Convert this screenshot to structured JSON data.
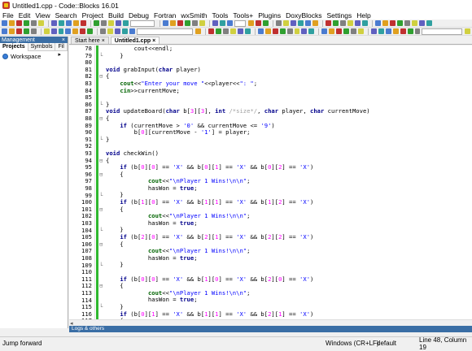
{
  "window": {
    "title": "Untitled1.cpp - Code::Blocks 16.01"
  },
  "menu": [
    "File",
    "Edit",
    "View",
    "Search",
    "Project",
    "Build",
    "Debug",
    "Fortran",
    "wxSmith",
    "Tools",
    "Tools+",
    "Plugins",
    "DoxyBlocks",
    "Settings",
    "Help"
  ],
  "management": {
    "title": "Management",
    "close": "×",
    "tabs": [
      "Projects",
      "Symbols",
      "Fil ▸"
    ],
    "workspace_label": "Workspace"
  },
  "editor_tabs": [
    {
      "label": "Start here",
      "close": "×"
    },
    {
      "label": "Untitled1.cpp",
      "close": "×"
    }
  ],
  "code_lines": [
    {
      "n": "78",
      "fold": "",
      "html": "        <span class='fn'>cout</span>&lt;&lt;endl;"
    },
    {
      "n": "79",
      "fold": "└",
      "html": "    }"
    },
    {
      "n": "80",
      "fold": "",
      "html": ""
    },
    {
      "n": "81",
      "fold": "",
      "html": "<span class='kw'>void</span> grabInput(<span class='kw'>char</span> player)"
    },
    {
      "n": "82",
      "fold": "⊟",
      "html": "{"
    },
    {
      "n": "83",
      "fold": "",
      "html": "    <span class='grn'>cout</span>&lt;&lt;<span class='str'>\"Enter your move \"</span>&lt;&lt;player&lt;&lt;<span class='str'>\": \"</span>;"
    },
    {
      "n": "84",
      "fold": "",
      "html": "    <span class='grn'>cin</span>&gt;&gt;currentMove;"
    },
    {
      "n": "85",
      "fold": "",
      "html": ""
    },
    {
      "n": "86",
      "fold": "└",
      "html": "}"
    },
    {
      "n": "87",
      "fold": "",
      "html": "<span class='kw'>void</span> updateBoard(<span class='kw'>char</span> b[<span class='num'>3</span>][<span class='num'>3</span>], <span class='kw'>int</span> <span class='com'>/*size*/</span>, <span class='kw'>char</span> player, <span class='kw'>char</span> currentMove)"
    },
    {
      "n": "88",
      "fold": "⊟",
      "html": "{"
    },
    {
      "n": "89",
      "fold": "",
      "html": "    <span class='kw'>if</span> (currentMove &gt; <span class='str'>'0'</span> &amp;&amp; currentMove &lt;= <span class='str'>'9'</span>)"
    },
    {
      "n": "90",
      "fold": "",
      "html": "        b[<span class='num'>0</span>][currentMove - <span class='str'>'1'</span>] = player;"
    },
    {
      "n": "91",
      "fold": "└",
      "html": "}"
    },
    {
      "n": "92",
      "fold": "",
      "html": ""
    },
    {
      "n": "93",
      "fold": "",
      "html": "<span class='kw'>void</span> checkWin()"
    },
    {
      "n": "94",
      "fold": "⊟",
      "html": "{"
    },
    {
      "n": "95",
      "fold": "",
      "html": "    <span class='kw'>if</span> (b[<span class='num'>0</span>][<span class='num'>0</span>] == <span class='str'>'X'</span> &amp;&amp; b[<span class='num'>0</span>][<span class='num'>1</span>] == <span class='str'>'X'</span> &amp;&amp; b[<span class='num'>0</span>][<span class='num'>2</span>] == <span class='str'>'X'</span>)"
    },
    {
      "n": "96",
      "fold": "⊟",
      "html": "    {"
    },
    {
      "n": "97",
      "fold": "",
      "html": "            <span class='grn'>cout</span>&lt;&lt;<span class='str'>\"\\nPlayer 1 Wins!\\n\\n\"</span>;"
    },
    {
      "n": "98",
      "fold": "",
      "html": "            hasWon = <span class='kw'>true</span>;"
    },
    {
      "n": "99",
      "fold": "└",
      "html": "    }"
    },
    {
      "n": "100",
      "fold": "",
      "html": "    <span class='kw'>if</span> (b[<span class='num'>1</span>][<span class='num'>0</span>] == <span class='str'>'X'</span> &amp;&amp; b[<span class='num'>1</span>][<span class='num'>1</span>] == <span class='str'>'X'</span> &amp;&amp; b[<span class='num'>1</span>][<span class='num'>2</span>] == <span class='str'>'X'</span>)"
    },
    {
      "n": "101",
      "fold": "⊟",
      "html": "    {"
    },
    {
      "n": "102",
      "fold": "",
      "html": "            <span class='grn'>cout</span>&lt;&lt;<span class='str'>\"\\nPlayer 1 Wins!\\n\\n\"</span>;"
    },
    {
      "n": "103",
      "fold": "",
      "html": "            hasWon = <span class='kw'>true</span>;"
    },
    {
      "n": "104",
      "fold": "└",
      "html": "    }"
    },
    {
      "n": "105",
      "fold": "",
      "html": "    <span class='kw'>if</span> (b[<span class='num'>2</span>][<span class='num'>0</span>] == <span class='str'>'X'</span> &amp;&amp; b[<span class='num'>2</span>][<span class='num'>1</span>] == <span class='str'>'X'</span> &amp;&amp; b[<span class='num'>2</span>][<span class='num'>2</span>] == <span class='str'>'X'</span>)"
    },
    {
      "n": "106",
      "fold": "⊟",
      "html": "    {"
    },
    {
      "n": "107",
      "fold": "",
      "html": "            <span class='grn'>cout</span>&lt;&lt;<span class='str'>\"\\nPlayer 1 Wins!\\n\\n\"</span>;"
    },
    {
      "n": "108",
      "fold": "",
      "html": "            hasWon = <span class='kw'>true</span>;"
    },
    {
      "n": "109",
      "fold": "└",
      "html": "    }"
    },
    {
      "n": "110",
      "fold": "",
      "html": ""
    },
    {
      "n": "111",
      "fold": "",
      "html": "    <span class='kw'>if</span> (b[<span class='num'>0</span>][<span class='num'>0</span>] == <span class='str'>'X'</span> &amp;&amp; b[<span class='num'>1</span>][<span class='num'>0</span>] == <span class='str'>'X'</span> &amp;&amp; b[<span class='num'>2</span>][<span class='num'>0</span>] == <span class='str'>'X'</span>)"
    },
    {
      "n": "112",
      "fold": "⊟",
      "html": "    {"
    },
    {
      "n": "113",
      "fold": "",
      "html": "            <span class='grn'>cout</span>&lt;&lt;<span class='str'>\"\\nPlayer 1 Wins!\\n\\n\"</span>;"
    },
    {
      "n": "114",
      "fold": "",
      "html": "            hasWon = <span class='kw'>true</span>;"
    },
    {
      "n": "115",
      "fold": "└",
      "html": "    }"
    },
    {
      "n": "116",
      "fold": "",
      "html": "    <span class='kw'>if</span> (b[<span class='num'>0</span>][<span class='num'>1</span>] == <span class='str'>'X'</span> &amp;&amp; b[<span class='num'>1</span>][<span class='num'>1</span>] == <span class='str'>'X'</span> &amp;&amp; b[<span class='num'>2</span>][<span class='num'>1</span>] == <span class='str'>'X'</span>)"
    },
    {
      "n": "117",
      "fold": "⊟",
      "html": "    {"
    },
    {
      "n": "118",
      "fold": "",
      "html": "            <span class='grn'>cout</span>&lt;&lt;<span class='str'>\"\\nPlayer 1 Wins!\\n\\n\"</span>;"
    }
  ],
  "logs_bar": "Logs & others",
  "status": {
    "message": "Jump forward",
    "eol": "Windows (CR+LF)",
    "encoding": "default",
    "position": "Line 48, Column 19"
  },
  "toolbar_colors": [
    "#4a7bd0",
    "#e0a020",
    "#c03030",
    "#30a030",
    "#808080",
    "#d0d040",
    "#6060c0",
    "#30a0a0"
  ]
}
